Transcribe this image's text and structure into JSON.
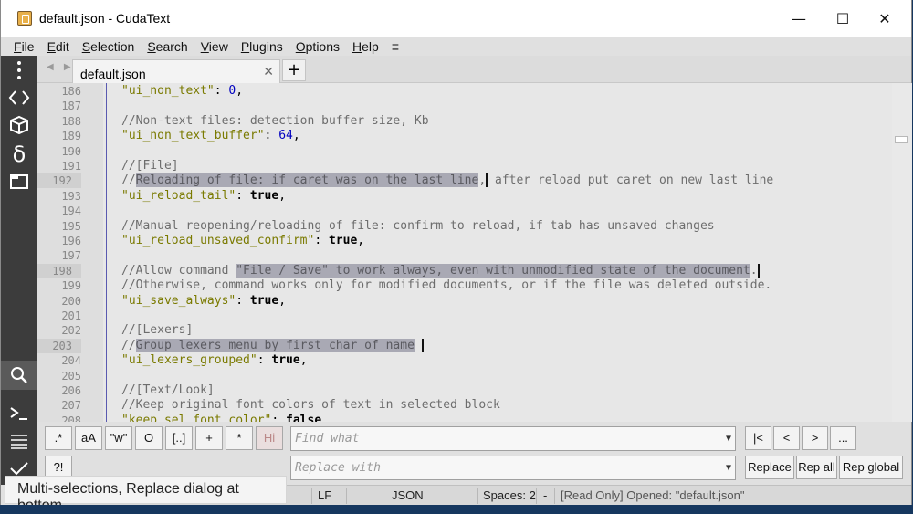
{
  "window": {
    "title": "default.json - CudaText",
    "min_glyph": "—",
    "max_glyph": "☐",
    "close_glyph": "✕"
  },
  "menu": [
    "File",
    "Edit",
    "Selection",
    "Search",
    "View",
    "Plugins",
    "Options",
    "Help",
    "≡"
  ],
  "menu_underline": [
    "F",
    "E",
    "S",
    "S",
    "V",
    "P",
    "O",
    "H",
    ""
  ],
  "sidebar": {
    "icons": [
      "menu-dots-icon",
      "code-tree-icon",
      "project-box-icon",
      "snippets-delta-icon",
      "tabs-icon",
      "search-icon",
      "console-icon",
      "output-list-icon",
      "validate-check-icon"
    ]
  },
  "tabs": [
    {
      "label": "default.json",
      "close": "✕"
    }
  ],
  "tab_add_label": "+",
  "editor": {
    "lines": [
      {
        "n": "186",
        "html": "<span class='str'>\"ui_non_text\"</span>: <span class='num'>0</span>,"
      },
      {
        "n": "187",
        "html": ""
      },
      {
        "n": "188",
        "html": "<span class='cmt'>//Non-text files: detection buffer size, Kb</span>"
      },
      {
        "n": "189",
        "html": "<span class='str'>\"ui_non_text_buffer\"</span>: <span class='num'>64</span>,"
      },
      {
        "n": "190",
        "html": ""
      },
      {
        "n": "191",
        "html": "<span class='cmt'>//[File]</span>"
      },
      {
        "n": "192",
        "cur": true,
        "html": "<span class='cmt'>//<span class='sel'>Reloading of file: if caret was on the last line</span><span class='caret'>,</span> after reload put caret on new last line</span>"
      },
      {
        "n": "193",
        "html": "<span class='str'>\"ui_reload_tail\"</span>: <span class='kw'>true</span>,"
      },
      {
        "n": "194",
        "html": ""
      },
      {
        "n": "195",
        "html": "<span class='cmt'>//Manual reopening/reloading of file: confirm to reload, if tab has unsaved changes</span>"
      },
      {
        "n": "196",
        "html": "<span class='str'>\"ui_reload_unsaved_confirm\"</span>: <span class='kw'>true</span>,"
      },
      {
        "n": "197",
        "html": ""
      },
      {
        "n": "198",
        "cur": true,
        "html": "<span class='cmt'>//Allow command <span class='sel'>\"File / Save\" to work always, even with unmodified state of the document</span><span class='caret'>.</span></span>"
      },
      {
        "n": "199",
        "html": "<span class='cmt'>//Otherwise, command works only for modified documents, or if the file was deleted outside.</span>"
      },
      {
        "n": "200",
        "html": "<span class='str'>\"ui_save_always\"</span>: <span class='kw'>true</span>,"
      },
      {
        "n": "201",
        "html": ""
      },
      {
        "n": "202",
        "html": "<span class='cmt'>//[Lexers]</span>"
      },
      {
        "n": "203",
        "cur": true,
        "html": "<span class='cmt'>//<span class='sel'>Group lexers menu by first char of name</span><span class='caret'> </span></span>"
      },
      {
        "n": "204",
        "html": "<span class='str'>\"ui_lexers_grouped\"</span>: <span class='kw'>true</span>,"
      },
      {
        "n": "205",
        "html": ""
      },
      {
        "n": "206",
        "html": "<span class='cmt'>//[Text/Look]</span>"
      },
      {
        "n": "207",
        "html": "<span class='cmt'>//Keep original font colors of text in selected block</span>"
      },
      {
        "n": "208",
        "html": "<span class='str'>\"keep_sel_font_color\"</span>: <span class='kw'>false</span>,"
      }
    ]
  },
  "find": {
    "opt_buttons": [
      ".*",
      "aA",
      "\"w\"",
      "O",
      "[..]",
      "+",
      "*",
      "Hi"
    ],
    "extra_button": "?!",
    "find_placeholder": "Find what",
    "replace_placeholder": "Replace with",
    "nav_buttons": [
      "|<",
      "<",
      ">",
      "..."
    ],
    "replace_buttons": [
      "Replace",
      "Rep all",
      "Rep global"
    ]
  },
  "status": {
    "eol": "LF",
    "lexer": "JSON",
    "tabs": "Spaces: 2",
    "dash": "-",
    "message": "[Read Only] Opened: \"default.json\""
  },
  "caption": "Multi-selections, Replace dialog at bottom"
}
